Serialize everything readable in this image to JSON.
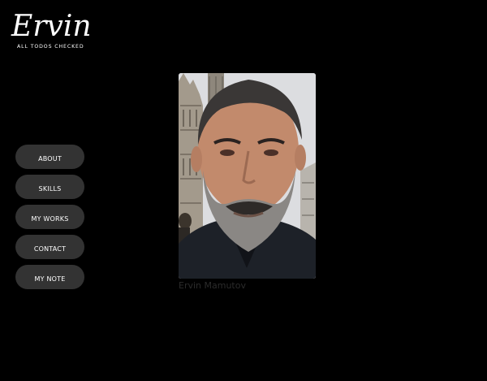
{
  "logo": {
    "name": "Ervin",
    "tagline": "ALL TODOS CHECKED"
  },
  "nav": {
    "items": [
      {
        "label": "ABOUT"
      },
      {
        "label": "SKILLS"
      },
      {
        "label": "MY WORKS"
      },
      {
        "label": "CONTACT"
      },
      {
        "label": "MY NOTE"
      }
    ]
  },
  "profile": {
    "caption": "Ervin Mamutov"
  },
  "colors": {
    "background": "#000000",
    "button": "#333333",
    "text": "#ffffff",
    "caption": "#2b2b2b"
  }
}
